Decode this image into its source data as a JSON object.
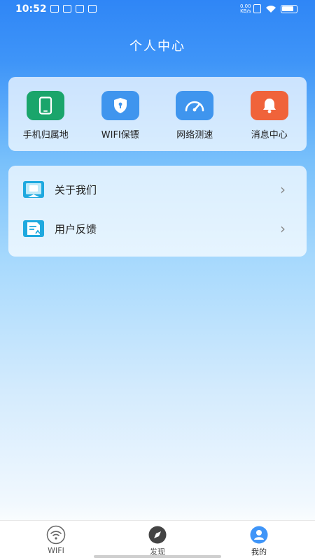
{
  "status_bar": {
    "time": "10:52",
    "net_speed_value": "0.00",
    "net_speed_unit": "KB/s"
  },
  "header": {
    "title": "个人中心"
  },
  "tools": [
    {
      "label": "手机归属地",
      "icon": "phone-icon",
      "color": "#1aa56b"
    },
    {
      "label": "WIFI保镖",
      "icon": "shield-icon",
      "color": "#3f95ee"
    },
    {
      "label": "网络测速",
      "icon": "speedometer-icon",
      "color": "#3f95ee"
    },
    {
      "label": "消息中心",
      "icon": "bell-icon",
      "color": "#f0633a"
    }
  ],
  "menu": [
    {
      "label": "关于我们",
      "icon": "info-card-icon"
    },
    {
      "label": "用户反馈",
      "icon": "feedback-icon"
    }
  ],
  "tab_bar": {
    "tabs": [
      {
        "label": "WIFI",
        "icon": "wifi-icon"
      },
      {
        "label": "发现",
        "icon": "compass-icon"
      },
      {
        "label": "我的",
        "icon": "person-icon"
      }
    ]
  },
  "colors": {
    "accent": "#3f95f8",
    "menu_icon": "#1fa9df"
  }
}
